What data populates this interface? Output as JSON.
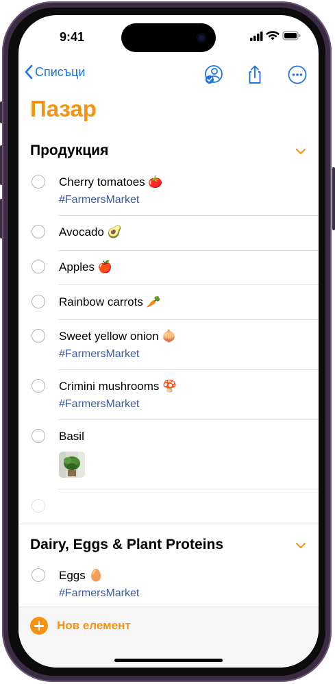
{
  "status_bar": {
    "time": "9:41"
  },
  "nav": {
    "back_label": "Списъци",
    "icons": {
      "share_people": "person-badge-icon",
      "share": "share-icon",
      "more": "ellipsis-icon"
    }
  },
  "list": {
    "title": "Пазар",
    "accent_color": "#f7920f",
    "tag_color": "#3b5aa0"
  },
  "sections": [
    {
      "name": "Продукция",
      "items": [
        {
          "label": "Cherry tomatoes 🍅",
          "tag": "#FarmersMarket"
        },
        {
          "label": "Avocado 🥑"
        },
        {
          "label": "Apples 🍎"
        },
        {
          "label": "Rainbow carrots 🥕"
        },
        {
          "label": "Sweet yellow onion 🧅",
          "tag": "#FarmersMarket"
        },
        {
          "label": "Crimini mushrooms 🍄",
          "tag": "#FarmersMarket"
        },
        {
          "label": "Basil",
          "has_image": true,
          "image_icon": "basil-photo"
        }
      ]
    },
    {
      "name": "Dairy, Eggs & Plant Proteins",
      "items": [
        {
          "label": "Eggs 🥚",
          "tag": "#FarmersMarket"
        }
      ]
    }
  ],
  "bottom_bar": {
    "add_label": "Нов елемент"
  }
}
